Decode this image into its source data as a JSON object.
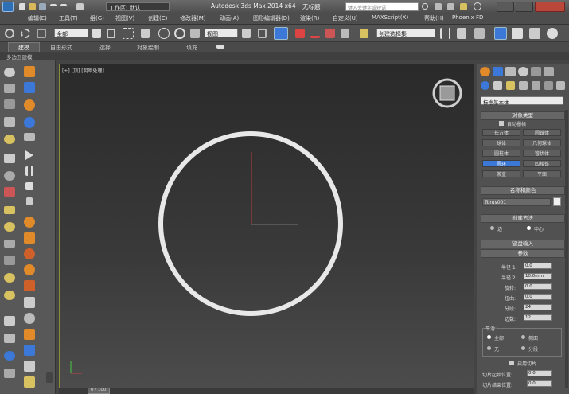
{
  "titlebar": {
    "workspace_label": "工作区: 默认",
    "app_title": "Autodesk 3ds Max 2014 x64",
    "doc_title": "无标题",
    "search_placeholder": "键入关键字或短语"
  },
  "menu": {
    "items": [
      "编辑(E)",
      "工具(T)",
      "组(G)",
      "视图(V)",
      "创建(C)",
      "修改器(M)",
      "动画(A)",
      "图形编辑器(D)",
      "渲染(R)",
      "自定义(U)",
      "MAXScript(X)",
      "帮助(H)",
      "Phoenix FD"
    ]
  },
  "toolbar": {
    "filter_dropdown": "全部",
    "refcoord_dropdown": "视图",
    "named_selection": "创建选择集"
  },
  "ribbon": {
    "tabs": [
      "建模",
      "自由形式",
      "选择",
      "对象绘制",
      "填充"
    ],
    "sub_label": "多边形建模"
  },
  "viewport": {
    "label": "[+] [顶] [明暗处理]",
    "status_counter": "0 / 100"
  },
  "command_panel": {
    "category_dropdown": "标准基本体",
    "object_type_header": "对象类型",
    "autogrid_label": "自动栅格",
    "object_buttons": [
      "长方体",
      "圆锥体",
      "球体",
      "几何球体",
      "圆柱体",
      "管状体",
      "圆环",
      "四棱锥",
      "茶壶",
      "平面"
    ],
    "name_color_header": "名称和颜色",
    "object_name": "Torus001",
    "creation_method_header": "创建方法",
    "creation_methods": [
      "边",
      "中心"
    ],
    "keyboard_entry_header": "键盘输入",
    "parameters_header": "参数",
    "params": [
      {
        "label": "半径 1:",
        "value": "0.0"
      },
      {
        "label": "半径 2:",
        "value": "10.0mm"
      },
      {
        "label": "旋转:",
        "value": "0.0"
      },
      {
        "label": "扭曲:",
        "value": "0.0"
      },
      {
        "label": "分段:",
        "value": "24"
      },
      {
        "label": "边数:",
        "value": "12"
      }
    ],
    "smooth_header": "平滑:",
    "smooth_options": [
      "全部",
      "侧面",
      "无",
      "分段"
    ],
    "slice_on_label": "启用切片",
    "slice_from_label": "切片起始位置:",
    "slice_from_value": "0.0",
    "slice_to_label": "切片结束位置:",
    "slice_to_value": "0.0"
  },
  "colors": {
    "accent_yellow": "#d7d77a",
    "active_blue": "#3b78d8",
    "torus_white": "#e8e8e8",
    "axis_red": "#b53a3a"
  }
}
